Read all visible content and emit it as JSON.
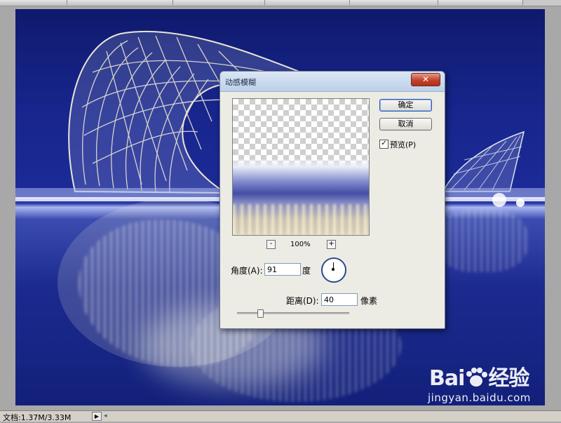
{
  "statusbar": {
    "doc_info": "文档:1.37M/3.33M"
  },
  "watermark": {
    "brand_left": "Bai",
    "brand_right": "经验",
    "url": "jingyan.baidu.com"
  },
  "dialog": {
    "title": "动感模糊",
    "close_label": "✕",
    "ok_label": "确定",
    "cancel_label": "取消",
    "preview_label": "预览(P)",
    "preview_checked": true,
    "zoom_out_label": "-",
    "zoom_in_label": "+",
    "zoom_level": "100%",
    "angle_label": "角度(A):",
    "angle_value": "91",
    "angle_unit": "度",
    "distance_label": "距离(D):",
    "distance_value": "40",
    "distance_unit": "像素"
  },
  "colors": {
    "canvas_sky": "#17258c",
    "dialog_bg": "#ecebe4",
    "close_red": "#c2422c",
    "accent_blue": "#2d5bb6"
  }
}
